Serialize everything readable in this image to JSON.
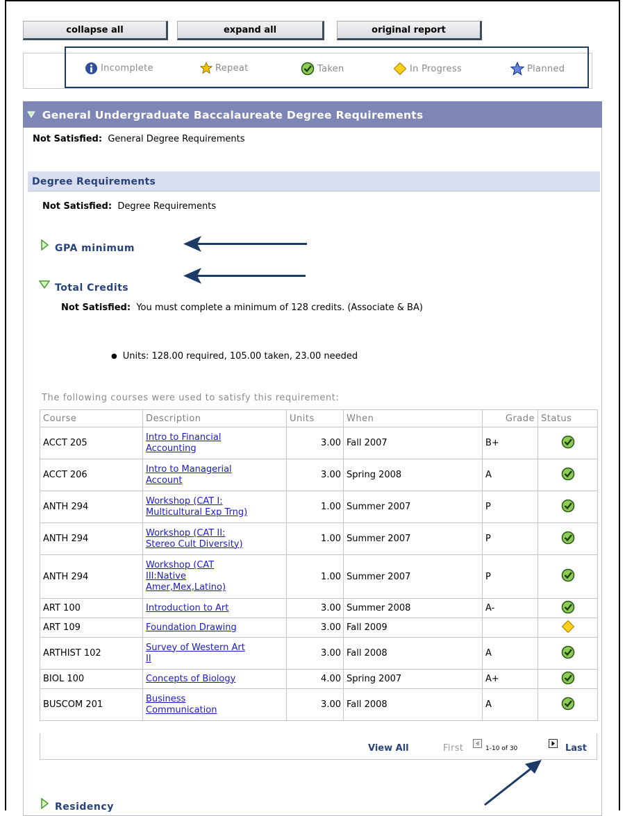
{
  "toolbar": {
    "collapse_label": "collapse all",
    "expand_label": "expand all",
    "original_label": "original report"
  },
  "legend": {
    "incomplete": "Incomplete",
    "repeat": "Repeat",
    "taken": "Taken",
    "in_progress": "In Progress",
    "planned": "Planned"
  },
  "colors": {
    "header": "#7d86b5",
    "subheader": "#d9dff0",
    "link": "#1a1acb",
    "taken_green": "#5aa02c",
    "in_progress_yellow": "#f2c200",
    "accent_navy": "#1d3b67"
  },
  "section": {
    "title": "General Undergraduate Baccalaureate Degree Requirements",
    "status_label": "Not Satisfied:",
    "status_text": "General Degree Requirements"
  },
  "degree_req": {
    "title": "Degree Requirements",
    "status_label": "Not Satisfied:",
    "status_text": "Degree Requirements",
    "gpa_label": "GPA minimum",
    "total_label": "Total Credits",
    "total_status_label": "Not Satisfied:",
    "total_status_text": "You must complete a minimum of 128 credits. (Associate & BA)",
    "units_text": "Units: 128.00 required, 105.00 taken, 23.00 needed",
    "courses_intro": "The following courses were used to satisfy this requirement:",
    "residency_label": "Residency"
  },
  "table": {
    "headers": {
      "course": "Course",
      "description": "Description",
      "units": "Units",
      "when": "When",
      "grade": "Grade",
      "status": "Status"
    },
    "rows": [
      {
        "course": "ACCT 205",
        "desc1": "Intro to Financial",
        "desc2": "Accounting",
        "desc3": "",
        "units": "3.00",
        "when": "Fall 2007",
        "grade": "B+",
        "status": "taken"
      },
      {
        "course": "ACCT 206",
        "desc1": "Intro to Managerial",
        "desc2": "Account",
        "desc3": "",
        "units": "3.00",
        "when": "Spring 2008",
        "grade": "A",
        "status": "taken"
      },
      {
        "course": "ANTH 294",
        "desc1": "Workshop (CAT I:",
        "desc2": "Multicultural Exp Trng)",
        "desc3": "",
        "units": "1.00",
        "when": "Summer 2007",
        "grade": "P",
        "status": "taken"
      },
      {
        "course": "ANTH 294",
        "desc1": "Workshop (CAT II:",
        "desc2": "Stereo Cult Diversity)",
        "desc3": "",
        "units": "1.00",
        "when": "Summer 2007",
        "grade": "P",
        "status": "taken"
      },
      {
        "course": "ANTH 294",
        "desc1": "Workshop (CAT",
        "desc2": "III:Native",
        "desc3": "Amer,Mex,Latino)",
        "units": "1.00",
        "when": "Summer 2007",
        "grade": "P",
        "status": "taken"
      },
      {
        "course": "ART 100",
        "desc1": "Introduction to Art",
        "desc2": "",
        "desc3": "",
        "units": "3.00",
        "when": "Summer 2008",
        "grade": "A-",
        "status": "taken"
      },
      {
        "course": "ART 109",
        "desc1": "Foundation Drawing",
        "desc2": "",
        "desc3": "",
        "units": "3.00",
        "when": "Fall 2009",
        "grade": "",
        "status": "in_progress"
      },
      {
        "course": "ARTHIST 102",
        "desc1": "Survey of Western Art",
        "desc2": "II",
        "desc3": "",
        "units": "3.00",
        "when": "Fall 2008",
        "grade": "A",
        "status": "taken"
      },
      {
        "course": "BIOL 100",
        "desc1": "Concepts of Biology",
        "desc2": "",
        "desc3": "",
        "units": "4.00",
        "when": "Spring 2007",
        "grade": "A+",
        "status": "taken"
      },
      {
        "course": "BUSCOM 201",
        "desc1": "Business",
        "desc2": "Communication",
        "desc3": "",
        "units": "3.00",
        "when": "Fall 2008",
        "grade": "A",
        "status": "taken"
      }
    ]
  },
  "pager": {
    "view_all": "View All",
    "first": "First",
    "range": "1-10 of 30",
    "last": "Last"
  }
}
